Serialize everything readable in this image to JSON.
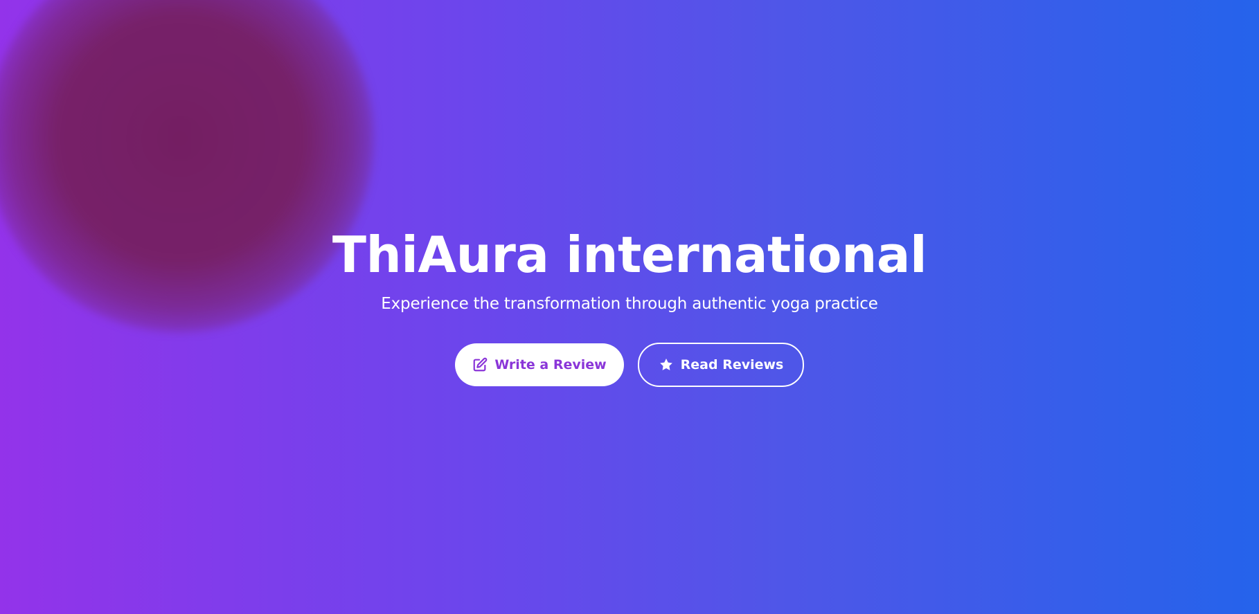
{
  "hero": {
    "title": "ThiAura international",
    "subtitle": "Experience the transformation through authentic yoga practice"
  },
  "actions": {
    "write_review": {
      "label": "Write a Review",
      "icon": "edit-icon"
    },
    "read_reviews": {
      "label": "Read Reviews",
      "icon": "star-icon"
    }
  },
  "colors": {
    "gradient_start": "#9333ea",
    "gradient_end": "#2563eb",
    "blob": "#741e5f",
    "primary_button_bg": "#ffffff",
    "primary_button_text": "#8a35d8",
    "text": "#ffffff"
  }
}
